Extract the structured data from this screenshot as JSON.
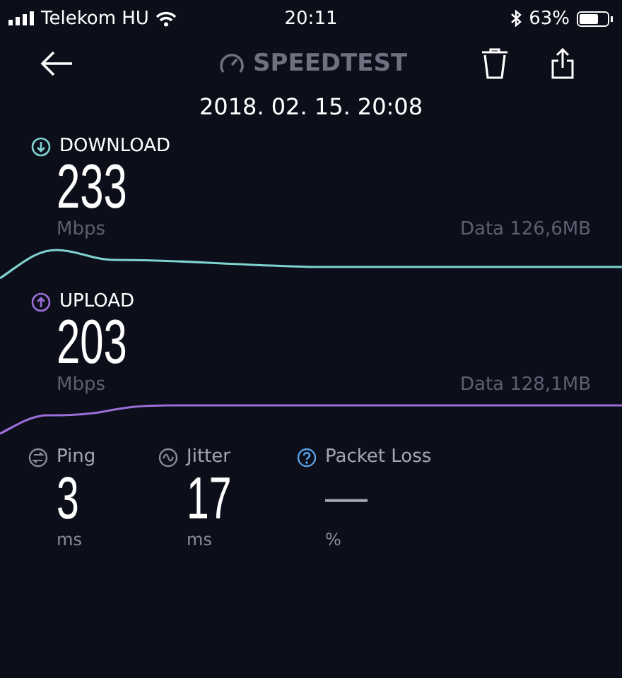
{
  "status_bar": {
    "carrier": "Telekom HU",
    "time": "20:11",
    "battery": "63%"
  },
  "header": {
    "logo": "SPEEDTEST"
  },
  "date": "2018. 02. 15. 20:08",
  "results": [
    {
      "kind": "download",
      "label": "DOWNLOAD",
      "value": "233",
      "unit": "Mbps",
      "data": "Data 126,6MB",
      "color": "#7fd3cf"
    },
    {
      "kind": "upload",
      "label": "UPLOAD",
      "value": "203",
      "unit": "Mbps",
      "data": "Data 128,1MB",
      "color": "#9b6fd6"
    }
  ],
  "stats": [
    {
      "kind": "ping",
      "label": "Ping",
      "value": "3",
      "unit": "ms",
      "color": "#8a8d99"
    },
    {
      "kind": "jitter",
      "label": "Jitter",
      "value": "17",
      "unit": "ms",
      "color": "#8a8d99"
    },
    {
      "kind": "packet_loss",
      "label": "Packet Loss",
      "value": "—",
      "unit": "%",
      "color": "#5aa2e6"
    }
  ]
}
